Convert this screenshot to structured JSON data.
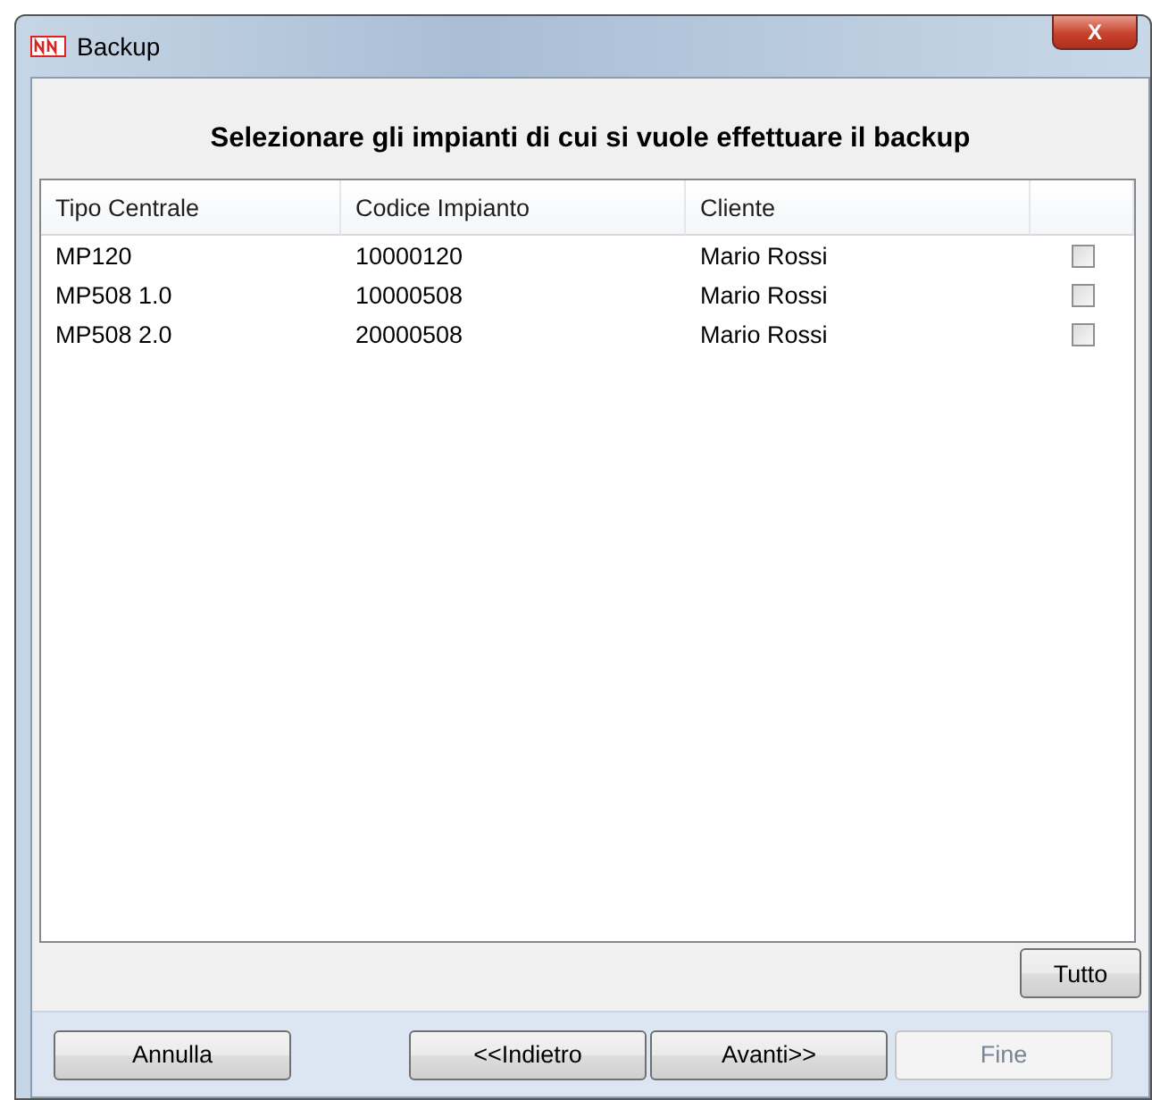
{
  "window": {
    "title": "Backup",
    "close": "X"
  },
  "heading": "Selezionare gli impianti di cui si vuole effettuare il backup",
  "table": {
    "columns": [
      "Tipo Centrale",
      "Codice Impianto",
      "Cliente"
    ],
    "rows": [
      {
        "cells": [
          "MP120",
          "10000120",
          "Mario Rossi"
        ],
        "checked": false
      },
      {
        "cells": [
          "MP508 1.0",
          "10000508",
          "Mario Rossi"
        ],
        "checked": false
      },
      {
        "cells": [
          "MP508 2.0",
          "20000508",
          "Mario Rossi"
        ],
        "checked": false
      }
    ]
  },
  "select_all": {
    "label": "Tutto",
    "disabled": false
  },
  "buttons": [
    {
      "label": "Annulla",
      "disabled": false
    },
    {
      "label": "<<Indietro",
      "disabled": false
    },
    {
      "label": "Avanti>>",
      "disabled": false
    },
    {
      "label": "Fine",
      "disabled": true
    }
  ]
}
